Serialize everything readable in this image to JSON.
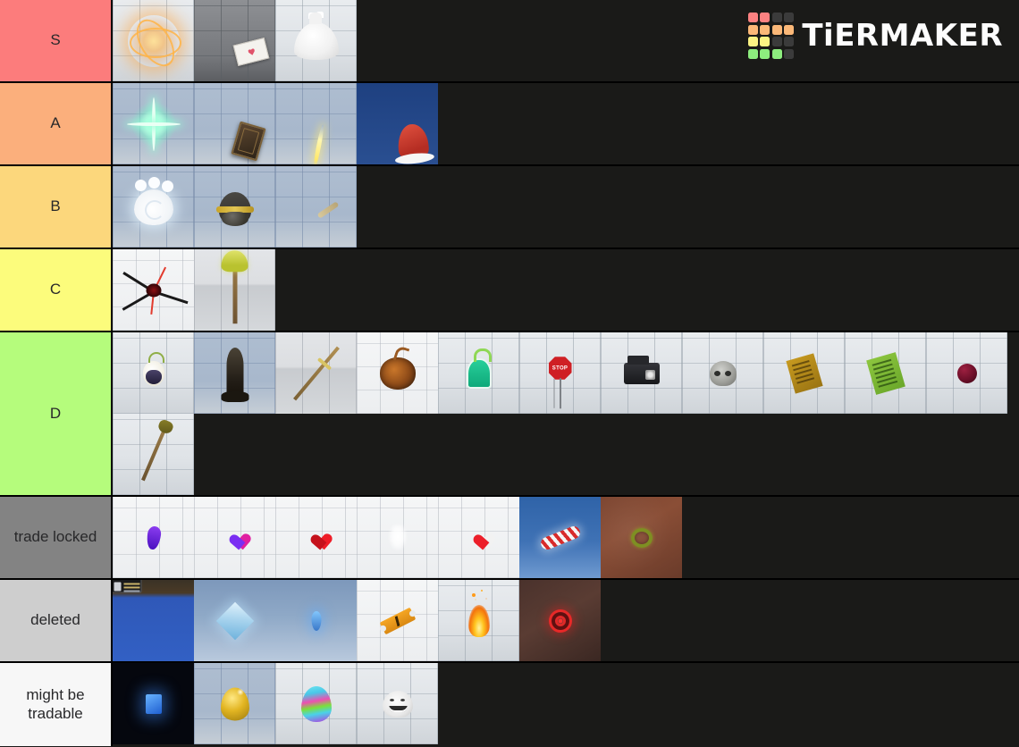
{
  "brand": {
    "name": "TiERMAKER",
    "logo_icon": "tiermaker-grid-logo",
    "logo_colors": [
      "#fb8181",
      "#fb8181",
      "#3b3b3b",
      "#3b3b3b",
      "#fbb878",
      "#fbb878",
      "#fbb878",
      "#fbb878",
      "#fbf383",
      "#fbf383",
      "#3b3b3b",
      "#3b3b3b",
      "#8ded7e",
      "#8ded7e",
      "#8ded7e",
      "#3b3b3b"
    ],
    "background": "#1a1a18"
  },
  "tiers": [
    {
      "label": "S",
      "color": "#fc7c7c",
      "items": [
        {
          "name": "glowing-orange-orb",
          "bg": "bg-tile-light",
          "sprite": "orb-ring"
        },
        {
          "name": "love-letter-envelope",
          "bg": "bg-tile-grey",
          "sprite": "envelope"
        },
        {
          "name": "white-sack-bag",
          "bg": "bg-tile-light",
          "sprite": "bag"
        }
      ]
    },
    {
      "label": "A",
      "color": "#fbaf7c",
      "items": [
        {
          "name": "green-sparkle-star",
          "bg": "bg-tile-blue",
          "sprite": "sparkle"
        },
        {
          "name": "dark-ancient-book",
          "bg": "bg-tile-blue",
          "sprite": "dark-book"
        },
        {
          "name": "yellow-light-streak",
          "bg": "bg-tile-blue",
          "sprite": "streak"
        },
        {
          "name": "red-santa-hat",
          "bg": "bg-navy",
          "sprite": "santa-hat"
        }
      ]
    },
    {
      "label": "B",
      "color": "#fcd77c",
      "items": [
        {
          "name": "white-glowing-paw",
          "bg": "bg-tile-blue",
          "sprite": "paw"
        },
        {
          "name": "military-helmet-head",
          "bg": "bg-tile-blue",
          "sprite": "helmet"
        },
        {
          "name": "wooden-stick",
          "bg": "bg-tile-blue",
          "sprite": "stick"
        }
      ]
    },
    {
      "label": "C",
      "color": "#fcfc7c",
      "items": [
        {
          "name": "black-red-splatter",
          "bg": "bg-tile-white",
          "sprite": "splat"
        },
        {
          "name": "slime-staff",
          "bg": "bg-tile-room",
          "sprite": "staff-slime"
        }
      ]
    },
    {
      "label": "D",
      "color": "#b5fc7c",
      "items": [
        {
          "name": "white-devil-fruit",
          "bg": "bg-tile-light",
          "sprite": "fruit-white"
        },
        {
          "name": "dark-rocket",
          "bg": "bg-tile-blue",
          "sprite": "rocket"
        },
        {
          "name": "golden-spear",
          "bg": "bg-tile-room",
          "sprite": "spear"
        },
        {
          "name": "orange-pumpkin-fruit",
          "bg": "bg-tile-white",
          "sprite": "pumpkin"
        },
        {
          "name": "green-devil-fruit",
          "bg": "bg-tile-light",
          "sprite": "green-fruit"
        },
        {
          "name": "stop-sign",
          "bg": "bg-tile-light",
          "sprite": "stop-sign"
        },
        {
          "name": "old-camera",
          "bg": "bg-tile-light",
          "sprite": "camera"
        },
        {
          "name": "stone-skull",
          "bg": "bg-tile-light",
          "sprite": "skull"
        },
        {
          "name": "gold-book",
          "bg": "bg-tile-light",
          "sprite": "book-gold"
        },
        {
          "name": "green-book",
          "bg": "bg-tile-light",
          "sprite": "book-green"
        },
        {
          "name": "red-apple",
          "bg": "bg-tile-light",
          "sprite": "apple-red"
        },
        {
          "name": "shovel",
          "bg": "bg-tile-light",
          "sprite": "shovel"
        }
      ]
    },
    {
      "label": "trade locked",
      "color": "#838383",
      "items": [
        {
          "name": "purple-flame",
          "bg": "bg-tile-white",
          "sprite": "flame-purple"
        },
        {
          "name": "pink-purple-heart",
          "bg": "bg-tile-white",
          "sprite": "heart pink"
        },
        {
          "name": "red-heart",
          "bg": "bg-tile-white",
          "sprite": "heart red"
        },
        {
          "name": "white-glow",
          "bg": "bg-tile-white",
          "sprite": "glow-white"
        },
        {
          "name": "red-white-heart",
          "bg": "bg-tile-white",
          "sprite": "heart redwhite"
        },
        {
          "name": "candy-cane",
          "bg": "bg-sky",
          "sprite": "candy-cane"
        },
        {
          "name": "green-ring",
          "bg": "bg-dirt",
          "sprite": "ring-green"
        }
      ]
    },
    {
      "label": "deleted",
      "color": "#cecece",
      "items": [
        {
          "name": "player-avatar-scene",
          "bg": "bg-gamescene",
          "sprite": "avatar-scene"
        },
        {
          "name": "ice-diamond",
          "bg": "bg-sky-light",
          "sprite": "diamond-ice"
        },
        {
          "name": "blue-crystal",
          "bg": "bg-sky-light",
          "sprite": "blue-crystal"
        },
        {
          "name": "orange-ticket",
          "bg": "bg-tile-white",
          "sprite": "ticket"
        },
        {
          "name": "fire-flame",
          "bg": "bg-tile-light",
          "sprite": "fire"
        },
        {
          "name": "red-target-ring",
          "bg": "bg-dirt-dark",
          "sprite": "target-red"
        }
      ]
    },
    {
      "label": "might be tradable",
      "color": "#f7f7f7",
      "items": [
        {
          "name": "blue-glowing-book",
          "bg": "bg-black",
          "sprite": "blue-book-glow"
        },
        {
          "name": "golden-egg",
          "bg": "bg-tile-blue",
          "sprite": "golden-egg"
        },
        {
          "name": "rainbow-egg",
          "bg": "bg-tile-light",
          "sprite": "rainbow-egg"
        },
        {
          "name": "troll-face",
          "bg": "bg-tile-light",
          "sprite": "troll"
        }
      ]
    }
  ]
}
